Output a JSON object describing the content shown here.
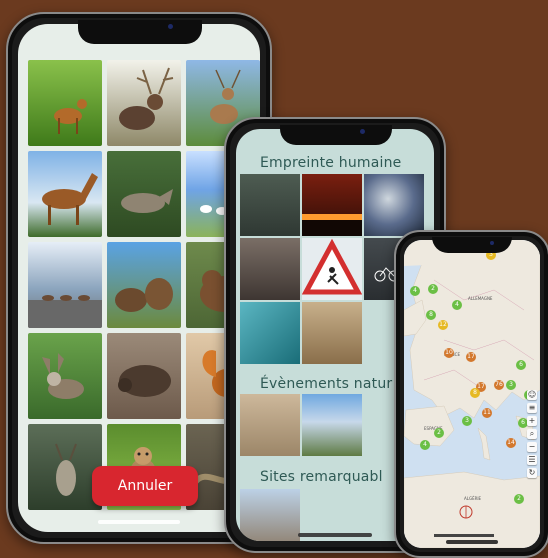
{
  "phone1": {
    "cancel_button": "Annuler",
    "tiles": [
      {
        "name": "photo-deer-grass",
        "bg": "linear-gradient(#8ac14b,#3f7a1a)"
      },
      {
        "name": "photo-stag-antlers",
        "bg": "linear-gradient(#f2f2ea,#8e8868)"
      },
      {
        "name": "photo-deer-meadow",
        "bg": "linear-gradient(#8fb8e6,#5d8c3b)"
      },
      {
        "name": "photo-horse",
        "bg": "linear-gradient(#7fb2e6,#d9e7f2 60%,#3e6b2a)"
      },
      {
        "name": "photo-wolf",
        "bg": "linear-gradient(#486f3a,#2e4a22)"
      },
      {
        "name": "photo-sheep-field",
        "bg": "linear-gradient(#c9e0ff,#6fa4e6 45%,#8bb35a)"
      },
      {
        "name": "photo-deer-road",
        "bg": "linear-gradient(#e6eef7,#8ba4bd 55%,#6a6f72)"
      },
      {
        "name": "photo-bears",
        "bg": "linear-gradient(#5aa3e4,#6c8a3e)"
      },
      {
        "name": "photo-brown-bear",
        "bg": "linear-gradient(#6e8a4c,#4d6635)"
      },
      {
        "name": "photo-donkey",
        "bg": "linear-gradient(#6aa34b,#3a6a2b)"
      },
      {
        "name": "photo-boar",
        "bg": "linear-gradient(#9b8a79,#6d5a4b)"
      },
      {
        "name": "photo-squirrel",
        "bg": "linear-gradient(#e1c9a8,#b89b79)"
      },
      {
        "name": "photo-goat-mountain",
        "bg": "linear-gradient(#5c6e58,#2d3e2b)"
      },
      {
        "name": "photo-marmot",
        "bg": "linear-gradient(#5b8d2e,#8dbf4a)"
      },
      {
        "name": "photo-snake",
        "bg": "linear-gradient(#6b6452,#4a4336)"
      }
    ]
  },
  "phone2": {
    "sections": [
      "Empreinte humaine",
      "Évènements natur",
      "Sites remarquabl"
    ],
    "empreinte_tiles": [
      {
        "name": "photo-diver",
        "bg": "linear-gradient(#4e5c52,#2f3833)"
      },
      {
        "name": "photo-fire-night",
        "bg": "linear-gradient(#7a1f10,#2a0c05)"
      },
      {
        "name": "photo-oil-swirl",
        "bg": "radial-gradient(circle at 40% 40%,#cfd7de,#5a6b8c 50%,#1f2a3a)"
      },
      {
        "name": "photo-rock-wall",
        "bg": "linear-gradient(#7a6e66,#3e3632)"
      },
      {
        "name": "photo-roadwork-sign",
        "bg": "#e6ecef"
      },
      {
        "name": "photo-bike-lane",
        "bg": "linear-gradient(#444a4e,#2a2e31)"
      },
      {
        "name": "photo-turquoise-debris",
        "bg": "linear-gradient(135deg,#5bb6c2,#1a6d78)"
      },
      {
        "name": "photo-crowd-beach",
        "bg": "linear-gradient(#c8b08b,#8a6e4a)"
      }
    ],
    "evenements_tiles": [
      {
        "name": "photo-sand-dunes",
        "bg": "linear-gradient(#cdb89b,#9c8668)"
      },
      {
        "name": "photo-coast-hill",
        "bg": "linear-gradient(#6fa8e0,#c7d8ea 45%,#5e7a44)"
      }
    ],
    "sites_tiles": [
      {
        "name": "photo-tower-ruins",
        "bg": "linear-gradient(#bcd1e6,#8b7a66)"
      }
    ]
  },
  "phone3": {
    "clusters": [
      {
        "label": "3",
        "color": "#e6b923"
      },
      {
        "label": "4",
        "color": "#6bbf45"
      },
      {
        "label": "2",
        "color": "#6bbf45"
      },
      {
        "label": "8",
        "color": "#6bbf45"
      },
      {
        "label": "12",
        "color": "#e6b923"
      },
      {
        "label": "4",
        "color": "#6bbf45"
      },
      {
        "label": "17",
        "color": "#d3782d"
      },
      {
        "label": "10",
        "color": "#d3782d"
      },
      {
        "label": "17",
        "color": "#d3782d"
      },
      {
        "label": "76",
        "color": "#d3782d"
      },
      {
        "label": "3",
        "color": "#6bbf45"
      },
      {
        "label": "6",
        "color": "#6bbf45"
      },
      {
        "label": "5",
        "color": "#6bbf45"
      },
      {
        "label": "3",
        "color": "#6bbf45"
      },
      {
        "label": "4",
        "color": "#6bbf45"
      },
      {
        "label": "2",
        "color": "#6bbf45"
      },
      {
        "label": "14",
        "color": "#d3782d"
      },
      {
        "label": "6",
        "color": "#6bbf45"
      },
      {
        "label": "2",
        "color": "#6bbf45"
      },
      {
        "label": "11",
        "color": "#d3782d"
      },
      {
        "label": "8",
        "color": "#e6b923"
      }
    ],
    "tool_icons": [
      "user-icon",
      "layers-icon",
      "plus-icon",
      "zoom-icon",
      "minus-icon",
      "menu-icon",
      "refresh-icon"
    ]
  }
}
